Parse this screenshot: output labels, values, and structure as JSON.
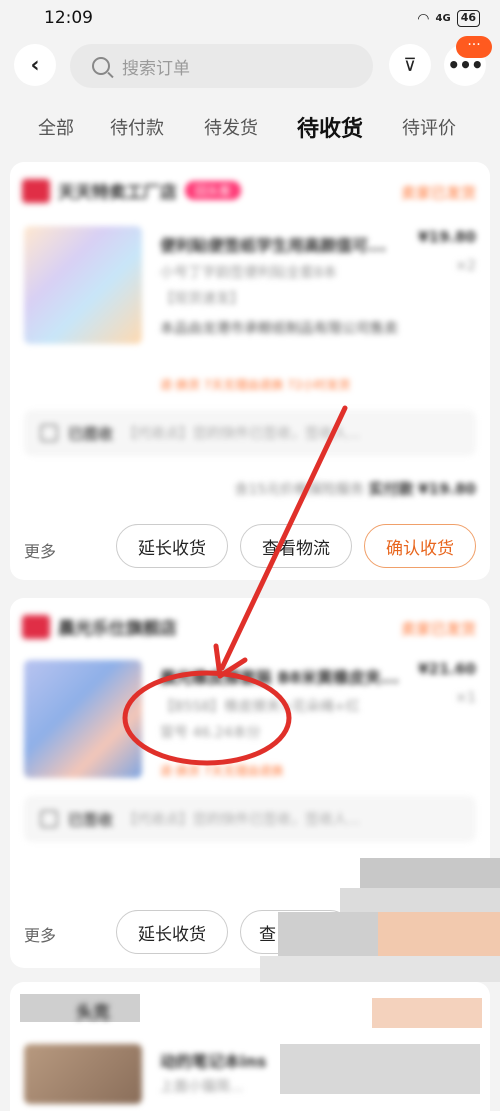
{
  "status_bar": {
    "time": "12:09",
    "network": "4G",
    "battery": "46"
  },
  "header": {
    "back_label": "‹",
    "search_placeholder": "搜索订单",
    "filter_label": "⊽",
    "more_label": "•••",
    "more_badge": "···"
  },
  "tabs": [
    {
      "label": "全部"
    },
    {
      "label": "待付款"
    },
    {
      "label": "待发货"
    },
    {
      "label": "待收货",
      "active": true
    },
    {
      "label": "待评价"
    }
  ],
  "orders": [
    {
      "shop_name": "天天特卖工厂店",
      "shop_tag": "回头客",
      "status": "卖家已发货",
      "item_title": "便利贴便签纸学生用高颜值可...",
      "item_spec": "小号丁字韵签便利贴全套8本",
      "item_tag": "【现货速发】",
      "item_shop": "本品由龙港市承鲸纸制品有限公司售卖",
      "price": "¥19.80",
      "qty": "×2",
      "promo": "退·换货   7天无理由退换   72小时发货",
      "logistics_status": "已揽收",
      "logistics_detail": "【代收点】您的快件已签收，签收人...",
      "summary_note": "含15元价格保险服务",
      "summary_label": "实付款",
      "summary_amount": "¥19.80",
      "more_label": "更多",
      "buttons": [
        "延长收货",
        "查看物流",
        "确认收货"
      ]
    },
    {
      "shop_name": "晨光乐仕旗舰店",
      "status": "卖家已发货",
      "item_title": "晨光橡皮擦套装 B8米黄橡皮夹...",
      "item_spec": "【B5S8】橡皮擦夹+花朵绳+红",
      "item_extra": "冒号 46.24本分",
      "price": "¥21.60",
      "qty": "×1",
      "promo": "退·换货   7天无理由退换",
      "logistics_status": "已签收",
      "logistics_detail": "【代收点】您的快件已签收，签收人...",
      "more_label": "更多",
      "buttons": [
        "延长收货",
        "查"
      ]
    },
    {
      "shop_name": "头克",
      "item_title": "动的笔记本ins",
      "item_spec": "上面小猫简..."
    }
  ],
  "colors": {
    "accent": "#ff6f2c",
    "annotation": "#e0302a",
    "badge": "#ff5a1f"
  }
}
